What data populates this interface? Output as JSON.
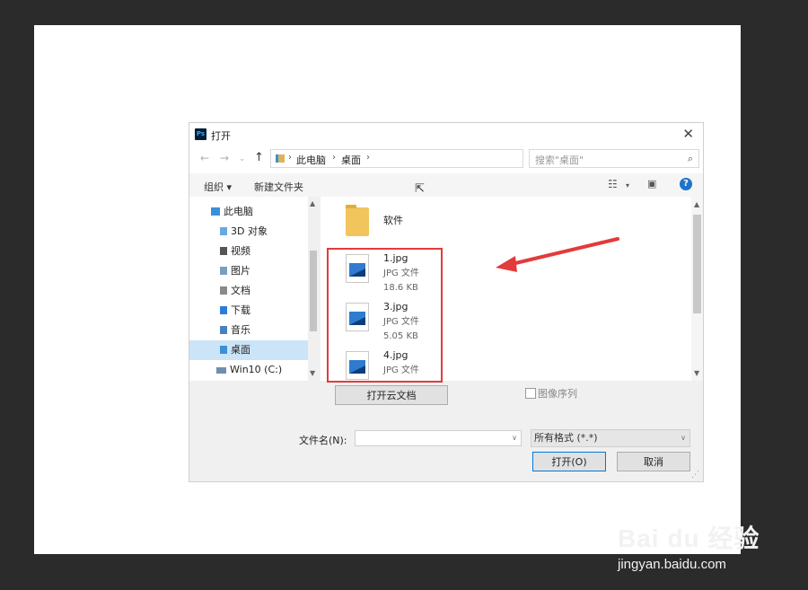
{
  "dialog": {
    "title": "打开",
    "app_icon_text": "Ps"
  },
  "navbar": {
    "breadcrumb": [
      "此电脑",
      "桌面"
    ],
    "search_placeholder": "搜索\"桌面\""
  },
  "toolbar": {
    "organize_label": "组织 ▾",
    "new_folder_label": "新建文件夹"
  },
  "sidebar": {
    "items": [
      {
        "label": "此电脑",
        "icon": "computer-icon",
        "color": "#3a8fd8"
      },
      {
        "label": "3D 对象",
        "icon": "3d-objects-icon",
        "color": "#6aa8e0"
      },
      {
        "label": "视频",
        "icon": "video-folder-icon",
        "color": "#555555"
      },
      {
        "label": "图片",
        "icon": "pictures-folder-icon",
        "color": "#7a9ec2"
      },
      {
        "label": "文档",
        "icon": "documents-folder-icon",
        "color": "#8a8a8a"
      },
      {
        "label": "下载",
        "icon": "download-folder-icon",
        "color": "#2f7ad6"
      },
      {
        "label": "音乐",
        "icon": "music-folder-icon",
        "color": "#4a7fc0"
      },
      {
        "label": "桌面",
        "icon": "desktop-folder-icon",
        "color": "#3a8fd8",
        "selected": true
      },
      {
        "label": "Win10 (C:)",
        "icon": "drive-icon",
        "color": "#6f8fb0"
      }
    ]
  },
  "files": [
    {
      "name": "软件",
      "type": "folder"
    },
    {
      "name": "1.jpg",
      "type_label": "JPG 文件",
      "size": "18.6 KB"
    },
    {
      "name": "3.jpg",
      "type_label": "JPG 文件",
      "size": "5.05 KB"
    },
    {
      "name": "4.jpg",
      "type_label": "JPG 文件",
      "size": ""
    }
  ],
  "bottom": {
    "open_cloud_label": "打开云文档",
    "image_sequence_label": "图像序列",
    "filename_label": "文件名(N):",
    "filename_value": "",
    "filetype_value": "所有格式 (*.*)",
    "open_label": "打开(O)",
    "cancel_label": "取消"
  },
  "watermark": {
    "logo": "Bai du 经验",
    "url": "jingyan.baidu.com"
  },
  "colors": {
    "highlight": "#e23b3b",
    "arrow": "#e23b3b",
    "selection": "#cce4f7",
    "accent": "#0078d7"
  }
}
